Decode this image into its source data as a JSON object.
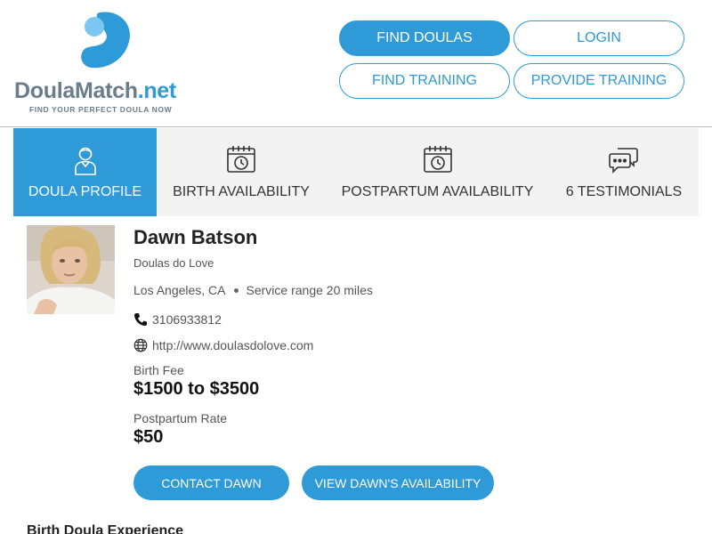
{
  "brand": {
    "logo_main": "DoulaMatch",
    "logo_suffix": ".net",
    "tagline": "FIND YOUR PERFECT DOULA NOW",
    "colors": {
      "primary": "#2e9ad8",
      "logo_gray": "#6a7d8c",
      "logo_light": "#7cc6f2"
    }
  },
  "nav": {
    "find_doulas": "FIND DOULAS",
    "login": "LOGIN",
    "find_training": "FIND TRAINING",
    "provide_training": "PROVIDE TRAINING"
  },
  "tabs": [
    {
      "label": "DOULA PROFILE",
      "icon": "person-icon",
      "active": true
    },
    {
      "label": "BIRTH AVAILABILITY",
      "icon": "calendar-clock-icon",
      "active": false
    },
    {
      "label": "POSTPARTUM AVAILABILITY",
      "icon": "calendar-clock-icon",
      "active": false
    },
    {
      "label": "6 TESTIMONIALS",
      "icon": "chat-bubbles-icon",
      "active": false
    }
  ],
  "profile": {
    "name": "Dawn Batson",
    "organization": "Doulas do Love",
    "location": "Los Angeles, CA",
    "service_range": "Service range 20 miles",
    "phone": "3106933812",
    "website": "http://www.doulasdolove.com",
    "birth_fee_label": "Birth Fee",
    "birth_fee": "$1500 to $3500",
    "postpartum_rate_label": "Postpartum Rate",
    "postpartum_rate": "$50",
    "contact_button": "CONTACT DAWN",
    "availability_button": "VIEW DAWN'S AVAILABILITY"
  },
  "sections": {
    "birth_doula_experience": "Birth Doula Experience"
  }
}
